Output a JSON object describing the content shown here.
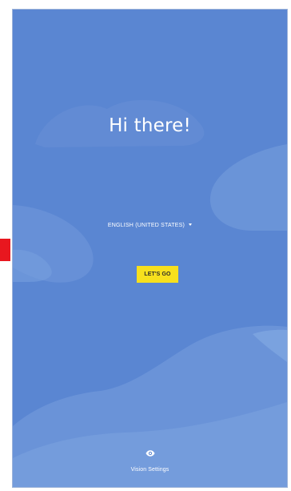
{
  "welcome": {
    "title": "Hi there!",
    "language_label": "ENGLISH (UNITED STATES)",
    "start_button_label": "LET'S GO",
    "vision_settings_label": "Vision Settings"
  },
  "icons": {
    "language_dropdown": "caret-down-icon",
    "vision_settings": "eye-icon"
  },
  "colors": {
    "background": "#5a86d2",
    "start_button": "#f7e01d",
    "marker": "#e8171f"
  }
}
